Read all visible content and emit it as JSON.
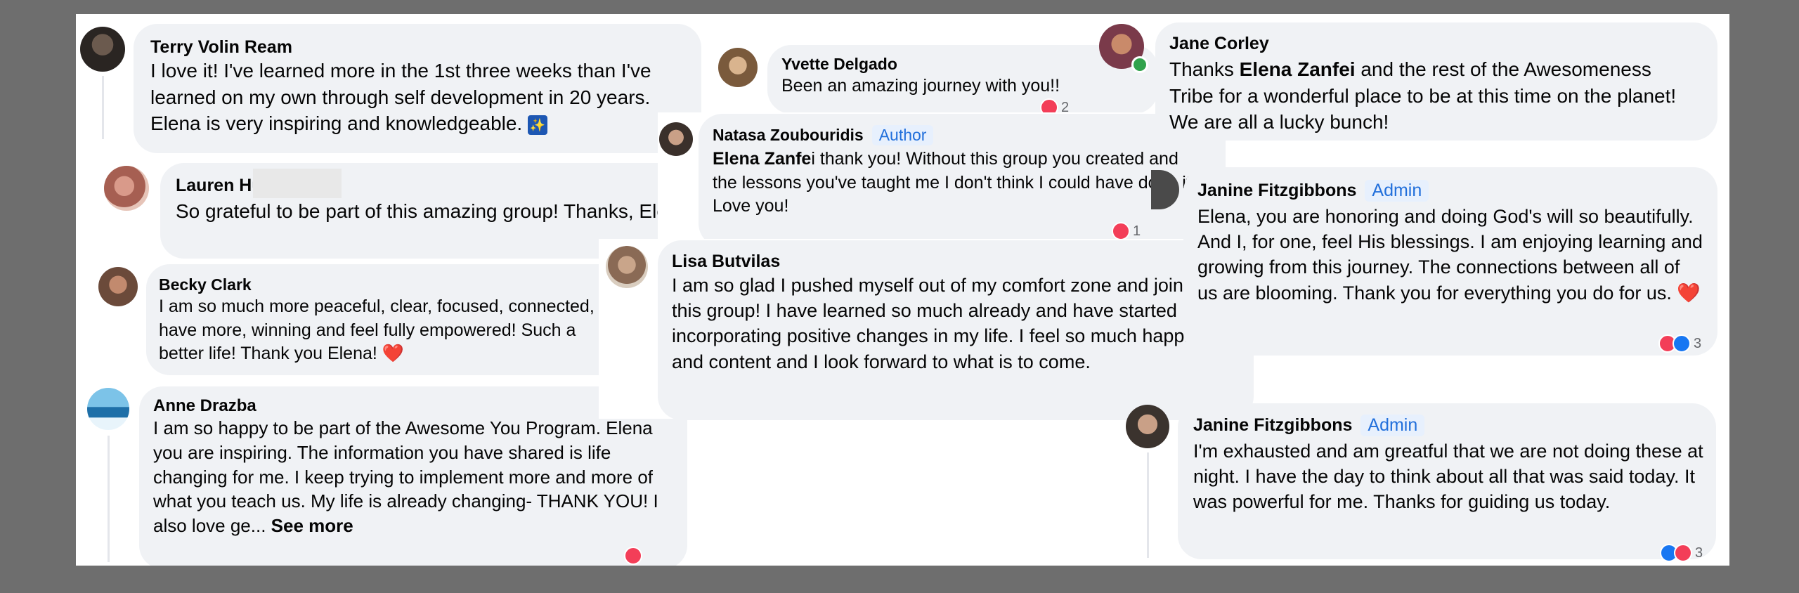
{
  "comments": [
    {
      "id": "terry",
      "name": "Terry Volin Ream",
      "text": "I love it! I've learned more in the 1st three weeks than I've learned on my own through self development in 20 years. Elena is very inspiring and knowledgeable.",
      "avatar": "avatar-terry",
      "emoji": "✨"
    },
    {
      "id": "lauren",
      "name": "Lauren Hu",
      "text": "So grateful to be part of this amazing group! Thanks, Elena!"
    },
    {
      "id": "becky",
      "name": "Becky Clark",
      "text": "I am so much more peaceful, clear, focused, connected, have more, winning and feel fully empowered! Such a better life! Thank you Elena!",
      "heart": "❤️"
    },
    {
      "id": "anne",
      "name": "Anne Drazba",
      "text": "I am so happy to be part of the Awesome You Program. Elena you are inspiring. The information you have shared is life changing for me. I keep trying to implement more and more of what you teach us. My life is already changing- THANK YOU! I also love ge...",
      "see_more": "See more"
    },
    {
      "id": "yvette",
      "name": "Yvette Delgado",
      "text": "Been an amazing journey with you!!",
      "reaction_count": "2"
    },
    {
      "id": "natasa",
      "name": "Natasa Zoubouridis",
      "badge": "Author",
      "mention": "Elena Zanfe",
      "text": "i thank you! Without this group you created and the lessons you've taught me I don't think I could have done it! Love you!",
      "reaction_count": "1"
    },
    {
      "id": "lisa",
      "name": "Lisa Butvilas",
      "text": "I am so glad I pushed myself out of my comfort zone and joined this group! I have learned so much already and have started incorporating positive changes in my life. I feel so much happier and content and I look forward to what is to come."
    },
    {
      "id": "jane",
      "name": "Jane Corley",
      "text_before": "Thanks ",
      "mention": "Elena Zanfei",
      "text_after": " and the rest of the Awesomeness Tribe for a wonderful place to be at this time on the planet! We are all a lucky bunch!"
    },
    {
      "id": "janine1",
      "name": "Janine Fitzgibbons",
      "badge": "Admin",
      "text": "Elena, you are honoring and doing God's will so beautifully. And I, for one, feel His blessings. I am enjoying learning and growing from this journey. The connections between all of us are blooming. Thank you for everything you do for us.",
      "heart": "❤️",
      "reaction_count": "3"
    },
    {
      "id": "janine2",
      "name": "Janine Fitzgibbons",
      "badge": "Admin",
      "text": "I'm exhausted and am greatful that we are not doing these at night. I have the day to think about all that was said today. It was powerful for me. Thanks for guiding us today.",
      "reaction_count": "3"
    }
  ],
  "colors": {
    "background": "#6e6e6e",
    "bubble": "#f0f2f5",
    "badge_text": "#216fdb",
    "badge_bg": "#e7f0fd",
    "like": "#1877f2",
    "love": "#f33e58"
  }
}
